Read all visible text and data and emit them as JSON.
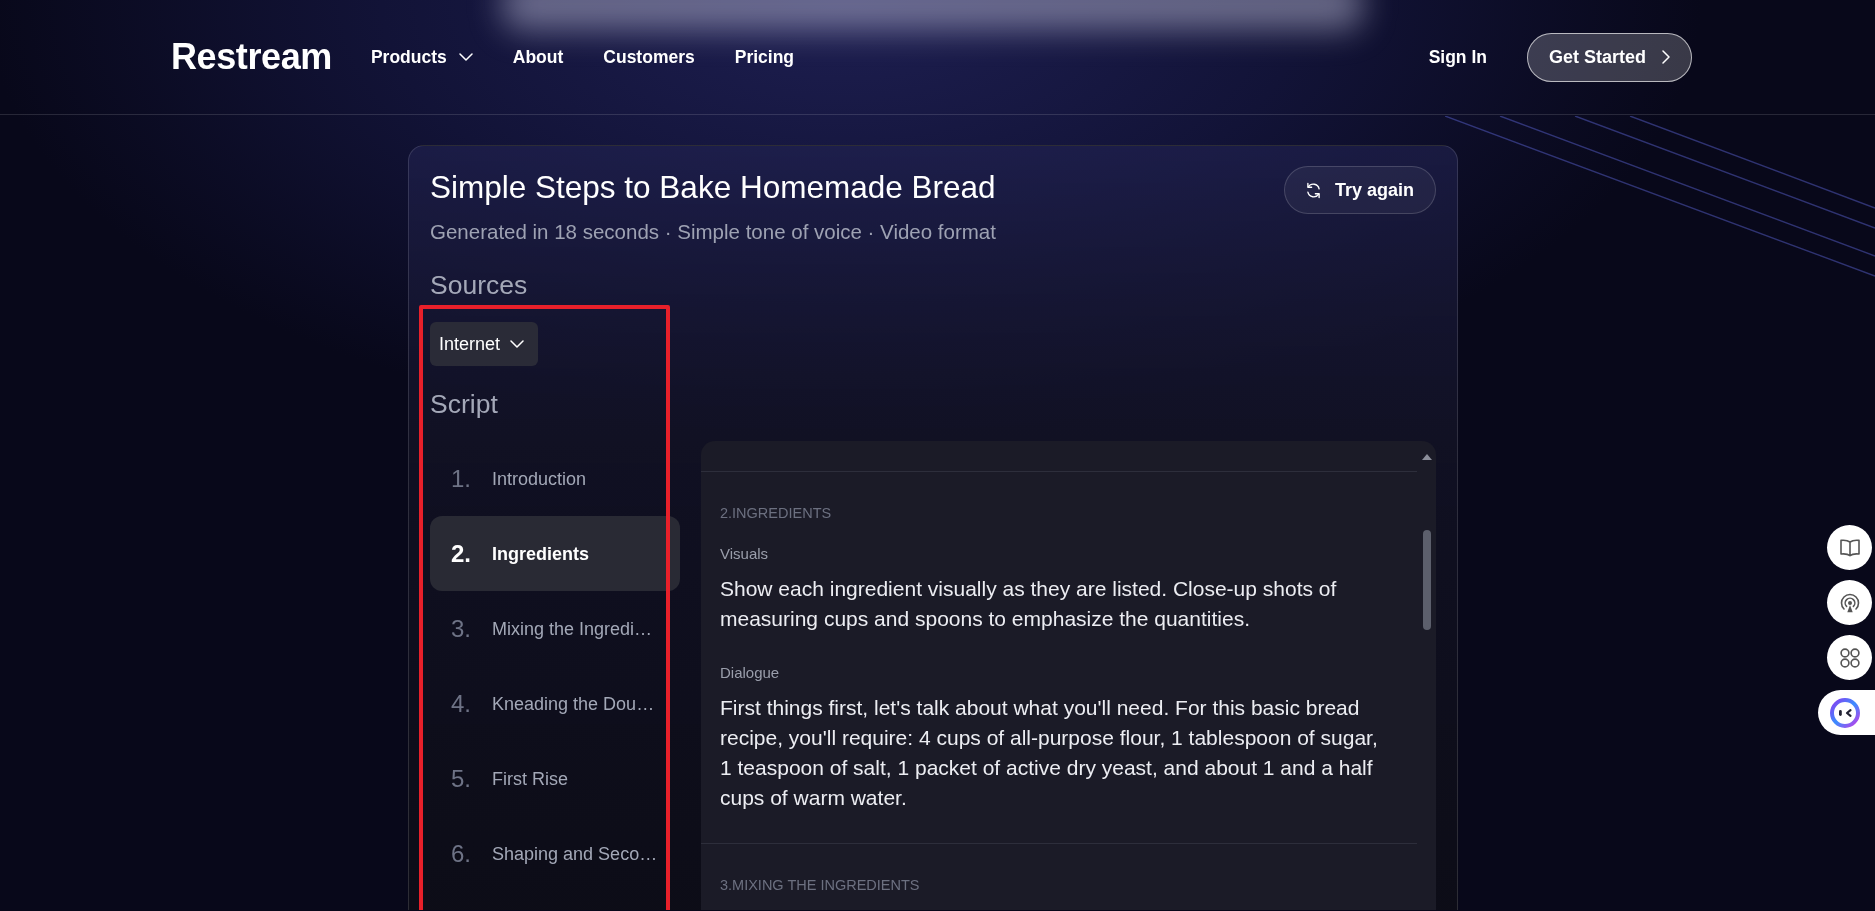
{
  "navbar": {
    "logo": "Restream",
    "links": [
      {
        "label": "Products",
        "dropdown": true
      },
      {
        "label": "About",
        "dropdown": false
      },
      {
        "label": "Customers",
        "dropdown": false
      },
      {
        "label": "Pricing",
        "dropdown": false
      }
    ],
    "sign_in": "Sign In",
    "get_started": "Get Started"
  },
  "result": {
    "title": "Simple Steps to Bake Homemade Bread",
    "info": "Generated in 18 seconds · Simple tone of voice · Video format",
    "try_again": "Try again",
    "sources_heading": "Sources",
    "source": "Internet",
    "script_heading": "Script",
    "highlight_frame": true,
    "script_items": [
      {
        "number": "1.",
        "label": "Introduction",
        "selected": false
      },
      {
        "number": "2.",
        "label": "Ingredients",
        "selected": true
      },
      {
        "number": "3.",
        "label": "Mixing the Ingredi…",
        "selected": false
      },
      {
        "number": "4.",
        "label": "Kneading the Dou…",
        "selected": false
      },
      {
        "number": "5.",
        "label": "First Rise",
        "selected": false
      },
      {
        "number": "6.",
        "label": "Shaping and Seco…",
        "selected": false
      }
    ]
  },
  "script_panel": {
    "sections": [
      {
        "heading": "2.INGREDIENTS",
        "blocks": [
          {
            "label": "Visuals",
            "text": "Show each ingredient visually as they are listed. Close-up shots of measuring cups and spoons to emphasize the quantities."
          },
          {
            "label": "Dialogue",
            "text": "First things first, let's talk about what you'll need. For this basic bread recipe, you'll require: 4 cups of all-purpose flour, 1 tablespoon of sugar, 1 teaspoon of salt, 1 packet of active dry yeast, and about 1 and a half cups of warm water."
          }
        ]
      },
      {
        "heading": "3.MIXING THE INGREDIENTS"
      }
    ]
  }
}
